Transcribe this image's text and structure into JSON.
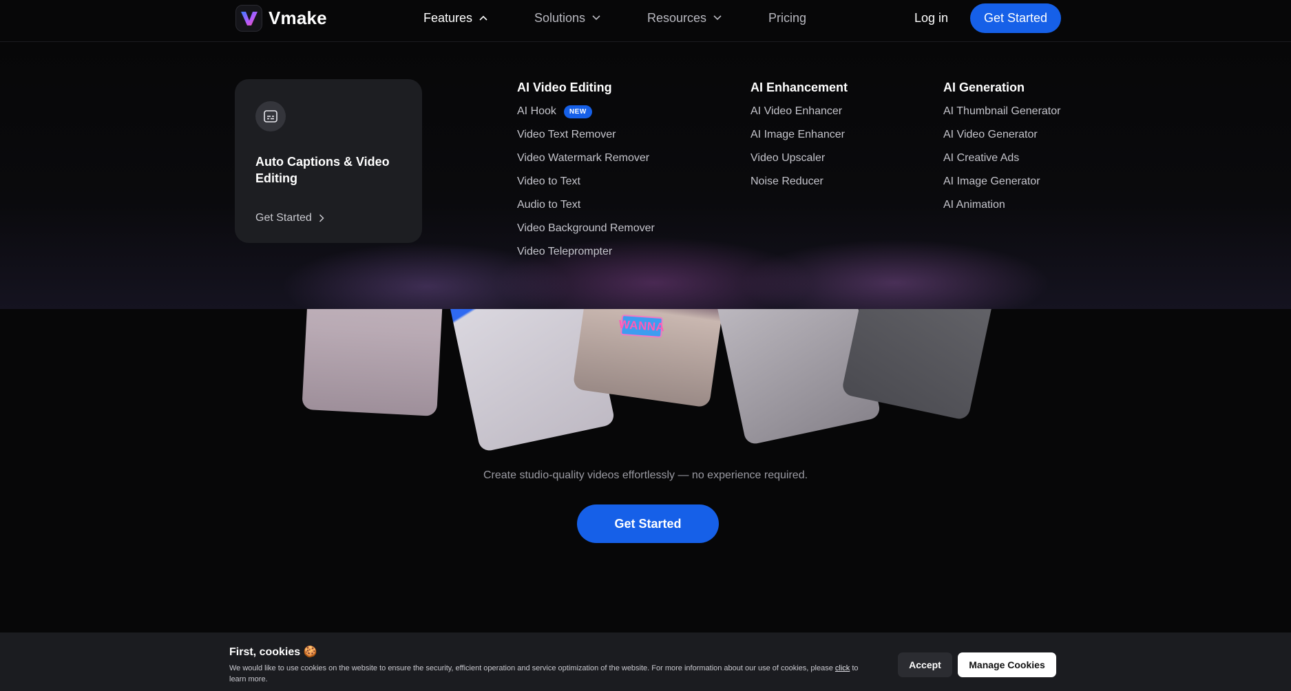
{
  "header": {
    "brand": "Vmake",
    "nav": [
      {
        "label": "Features",
        "state": "open"
      },
      {
        "label": "Solutions"
      },
      {
        "label": "Resources"
      },
      {
        "label": "Pricing"
      }
    ],
    "login_label": "Log in",
    "cta_label": "Get Started"
  },
  "dropdown": {
    "card": {
      "icon": "captions-icon",
      "title": "Auto Captions & Video Editing",
      "link_label": "Get Started"
    },
    "columns": [
      {
        "heading": "AI Video Editing",
        "items": [
          {
            "label": "AI Hook",
            "badge": "NEW"
          },
          {
            "label": "Video Text Remover"
          },
          {
            "label": "Video Watermark Remover"
          },
          {
            "label": "Video to Text"
          },
          {
            "label": "Audio to Text"
          },
          {
            "label": "Video Background Remover"
          },
          {
            "label": "Video Teleprompter"
          }
        ]
      },
      {
        "heading": "AI Enhancement",
        "items": [
          {
            "label": "AI Video Enhancer"
          },
          {
            "label": "AI Image Enhancer"
          },
          {
            "label": "Video Upscaler"
          },
          {
            "label": "Noise Reducer"
          }
        ]
      },
      {
        "heading": "AI Generation",
        "items": [
          {
            "label": "AI Thumbnail Generator"
          },
          {
            "label": "AI Video Generator"
          },
          {
            "label": "AI Creative Ads"
          },
          {
            "label": "AI Image Generator"
          },
          {
            "label": "AI Animation"
          }
        ]
      }
    ]
  },
  "hero": {
    "sticker_text": "WANNA",
    "subtitle": "Create studio-quality videos effortlessly — no experience required.",
    "cta_label": "Get Started"
  },
  "cookie": {
    "title": "First, cookies",
    "text_line": "We would like to use cookies on the website to ensure the security, efficient operation and service optimization of the website. For more information about our use of cookies, please",
    "link_label": "click",
    "text_tail": "to learn more.",
    "accept_label": "Accept",
    "manage_label": "Manage Cookies"
  },
  "colors": {
    "accent": "#1660e8",
    "background": "#070708",
    "card": "#1d1e22"
  }
}
